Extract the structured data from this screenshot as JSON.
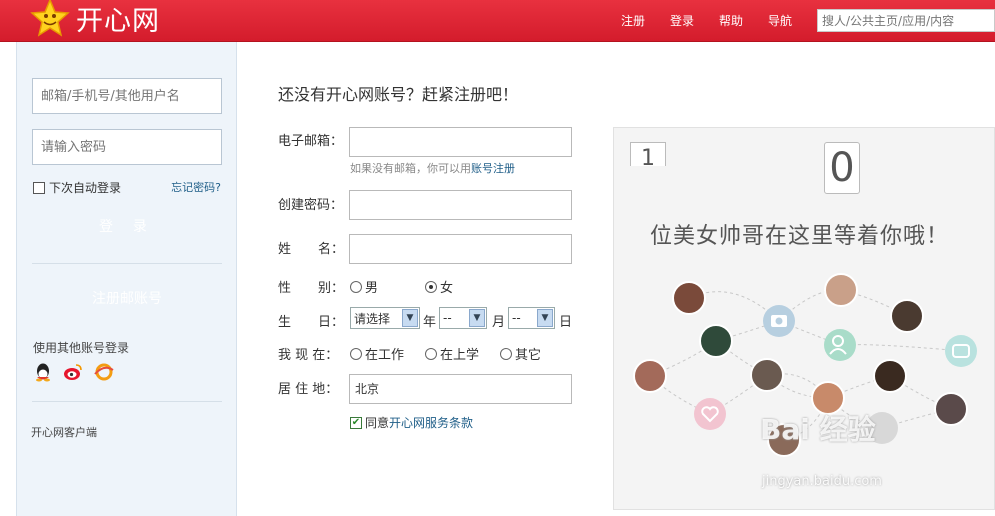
{
  "header": {
    "logo_text": "开心网",
    "nav": [
      "注册",
      "登录",
      "帮助",
      "导航"
    ],
    "search_placeholder": "搜人/公共主页/应用/内容"
  },
  "login": {
    "username_placeholder": "邮箱/手机号/其他用户名",
    "password_placeholder": "请输入密码",
    "remember_label": "下次自动登录",
    "forgot_label": "忘记密码?",
    "login_button": "登 录",
    "register_mail": "注册邮账号",
    "other_login_label": "使用其他账号登录",
    "client_label": "开心网客户端"
  },
  "form": {
    "title": "还没有开心网账号？赶紧注册吧！",
    "email_label": "电子邮箱：",
    "email_hint_prefix": "如果没有邮箱，你可以用",
    "email_hint_link": "账号注册",
    "password_label": "创建密码：",
    "name_label_1": "姓",
    "name_label_2": "名：",
    "gender_label_1": "性",
    "gender_label_2": "别：",
    "gender_male": "男",
    "gender_female": "女",
    "birthday_label_1": "生",
    "birthday_label_2": "日：",
    "birth_year_value": "请选择",
    "year_unit": "年",
    "birth_month_value": "--",
    "month_unit": "月",
    "birth_day_value": "--",
    "day_unit": "日",
    "status_label": "我 现 在：",
    "status_work": "在工作",
    "status_school": "在上学",
    "status_other": "其它",
    "residence_label": "居 住 地：",
    "residence_value": "北京",
    "agree_prefix": "同意",
    "agree_link": "开心网服务条款"
  },
  "promo": {
    "digit_1": "1",
    "digit_2": "0",
    "text": "位美女帅哥在这里等着你哦！"
  },
  "watermark": {
    "line1": "Bai 经验",
    "line2": "jingyan.baidu.com"
  }
}
